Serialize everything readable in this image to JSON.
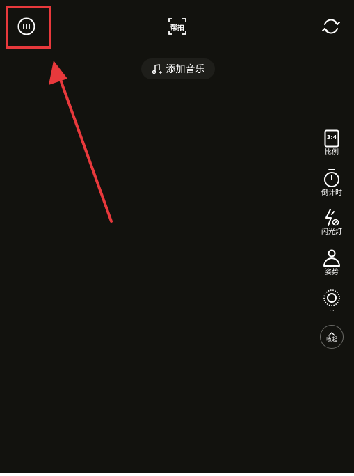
{
  "top_bar": {
    "menu_icon": "menu-dots-circle-icon",
    "assist_label": "帮拍",
    "flip_icon": "camera-flip-icon"
  },
  "music": {
    "icon": "music-note-plus-icon",
    "label": "添加音乐"
  },
  "side_tools": [
    {
      "id": "ratio",
      "icon": "aspect-ratio-icon",
      "icon_text": "3:4",
      "label": "比例"
    },
    {
      "id": "timer",
      "icon": "timer-icon",
      "label": "倒计时"
    },
    {
      "id": "flash",
      "icon": "flash-off-icon",
      "label": "闪光灯"
    },
    {
      "id": "pose",
      "icon": "pose-person-icon",
      "label": "姿势"
    },
    {
      "id": "beauty",
      "icon": "beauty-ring-icon",
      "label": "· ·"
    }
  ],
  "collapse": {
    "icon": "chevron-up-icon",
    "label": "收起"
  },
  "colors": {
    "background": "#12120e",
    "highlight": "#e8393c",
    "text": "#ffffff"
  }
}
